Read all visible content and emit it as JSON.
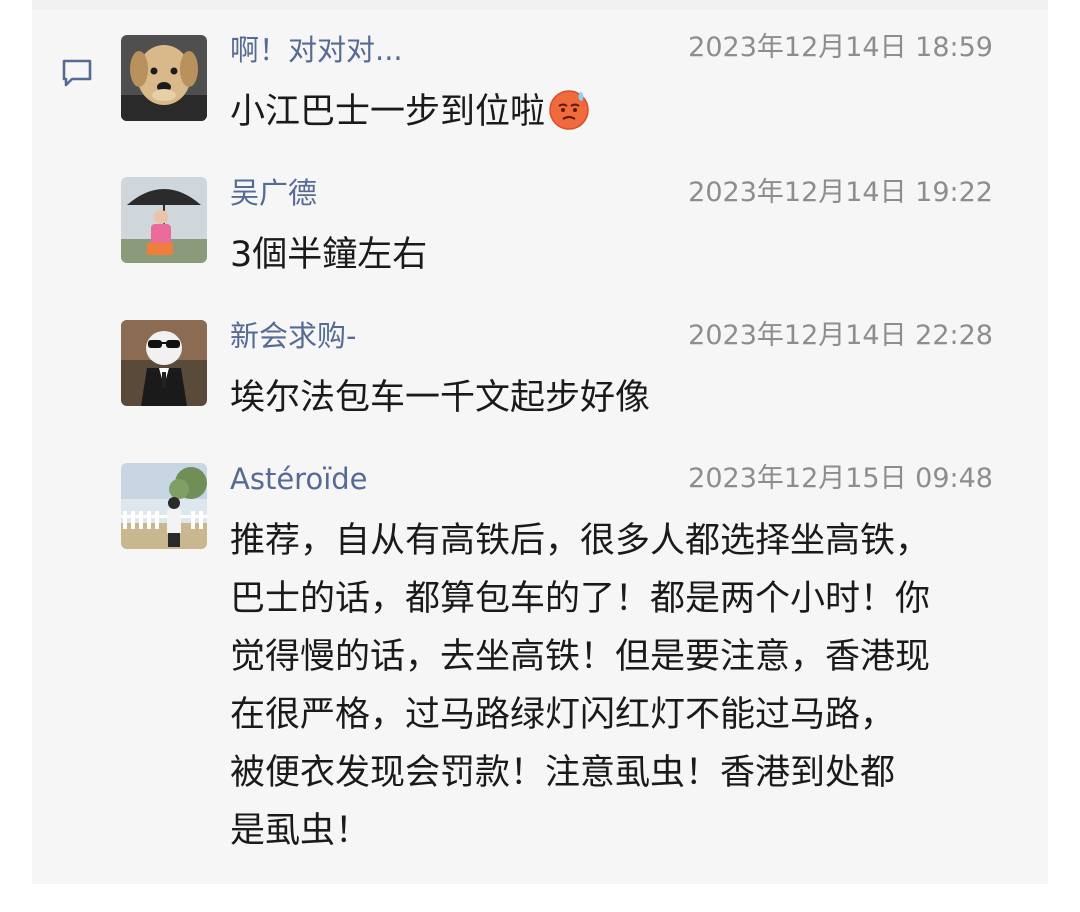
{
  "comments": [
    {
      "nickname": "啊！对对对...",
      "time": "2023年12月14日 18:59",
      "text": "小江巴士一步到位啦",
      "emoji": "sweat-face-emoji",
      "avatar": "dog-avatar"
    },
    {
      "nickname": "吴广德",
      "time": "2023年12月14日 19:22",
      "text": "3個半鐘左右",
      "avatar": "girl-umbrella-avatar"
    },
    {
      "nickname": "新会求购-",
      "time": "2023年12月14日 22:28",
      "text": "埃尔法包车一千文起步好像",
      "avatar": "cat-suit-avatar"
    },
    {
      "nickname": "Astéroïde",
      "time": "2023年12月15日 09:48",
      "lines": [
        "推荐，自从有高铁后，很多人都选择坐高铁，",
        "巴士的话，都算包车的了！都是两个小时！你",
        "觉得慢的话，去坐高铁！但是要注意，香港现",
        "在很严格，过马路绿灯闪红灯不能过马路，",
        "被便衣发现会罚款！注意虱虫！香港到处都",
        "是虱虫！"
      ],
      "avatar": "outdoor-fence-avatar"
    }
  ],
  "icons": {
    "comment": "comment-icon"
  },
  "colors": {
    "nickname": "#566b94",
    "time": "#8d8d8d",
    "text": "#1a1a1a",
    "panel": "#f6f6f6"
  }
}
